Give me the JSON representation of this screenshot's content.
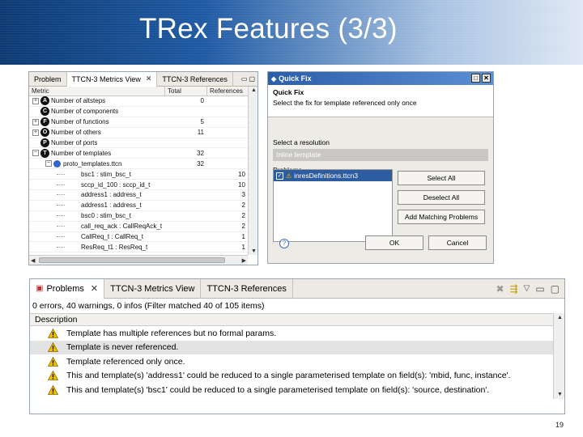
{
  "slide": {
    "title": "TRex Features  (3/3)",
    "page_number": "19"
  },
  "metrics_view": {
    "tabs": [
      {
        "label": "Problem"
      },
      {
        "label": "TTCN-3 Metrics View"
      },
      {
        "label": "TTCN-3 References"
      }
    ],
    "columns": [
      "Metric",
      "Total",
      "References"
    ],
    "rows": [
      {
        "expander": "+",
        "badge": "A",
        "name": "Number of altsteps",
        "total": "0",
        "refs": ""
      },
      {
        "expander": "",
        "badge": "C",
        "name": "Number of components",
        "total": "",
        "refs": ""
      },
      {
        "expander": "+",
        "badge": "F",
        "name": "Number of functions",
        "total": "5",
        "refs": ""
      },
      {
        "expander": "+",
        "badge": "O",
        "name": "Number of others",
        "total": "11",
        "refs": ""
      },
      {
        "expander": "",
        "badge": "P",
        "name": "Number of ports",
        "total": "",
        "refs": ""
      },
      {
        "expander": "−",
        "badge": "T",
        "name": "Number of templates",
        "total": "32",
        "refs": ""
      },
      {
        "expander": "−",
        "badge": "",
        "name": "proto_templates.ttcn",
        "total": "32",
        "refs": ""
      },
      {
        "expander": "",
        "badge": "",
        "name": "bsc1 : stim_bsc_t",
        "total": "",
        "refs": "10"
      },
      {
        "expander": "",
        "badge": "",
        "name": "sccp_id_100 : sccp_id_t",
        "total": "",
        "refs": "10"
      },
      {
        "expander": "",
        "badge": "",
        "name": "address1 : address_t",
        "total": "",
        "refs": "3"
      },
      {
        "expander": "",
        "badge": "",
        "name": "address1 : address_t",
        "total": "",
        "refs": "2"
      },
      {
        "expander": "",
        "badge": "",
        "name": "bsc0 : stim_bsc_t",
        "total": "",
        "refs": "2"
      },
      {
        "expander": "",
        "badge": "",
        "name": "call_req_ack : CallReqAck_t",
        "total": "",
        "refs": "2"
      },
      {
        "expander": "",
        "badge": "",
        "name": "CallReq_t : CallReq_t",
        "total": "",
        "refs": "1"
      },
      {
        "expander": "",
        "badge": "",
        "name": "ResReq_t1 : ResReq_t",
        "total": "",
        "refs": "1"
      }
    ]
  },
  "quick_fix": {
    "window_title": "Quick Fix",
    "header_title": "Quick Fix",
    "header_text": "Select the fix for template referenced only once",
    "resolution_label": "Select a resolution",
    "resolution_selected": "Inline template",
    "problems_label": "Problems",
    "problem_item": "inresDefinitions.ttcn3",
    "buttons": {
      "select_all": "Select All",
      "deselect_all": "Deselect All",
      "add_matching": "Add Matching Problems",
      "ok": "OK",
      "cancel": "Cancel"
    },
    "help": "?"
  },
  "problems_view": {
    "tabs": [
      {
        "label": "Problems"
      },
      {
        "label": "TTCN-3 Metrics View"
      },
      {
        "label": "TTCN-3 References"
      }
    ],
    "filter_text": "0 errors, 40 warnings, 0 infos (Filter matched 40 of 105 items)",
    "column": "Description",
    "rows": [
      "Template has multiple references but no formal params.",
      "Template is never referenced.",
      "Template referenced only once.",
      "This and template(s) 'address1' could be reduced to a single parameterised template on field(s): 'mbid, func, instance'.",
      "This and template(s) 'bsc1' could be reduced to a single parameterised template on field(s): 'source, destination'."
    ]
  },
  "colors": {
    "title_band": "#1f5aa3",
    "selection": "#2d5da0",
    "warning": "#f2c200"
  }
}
